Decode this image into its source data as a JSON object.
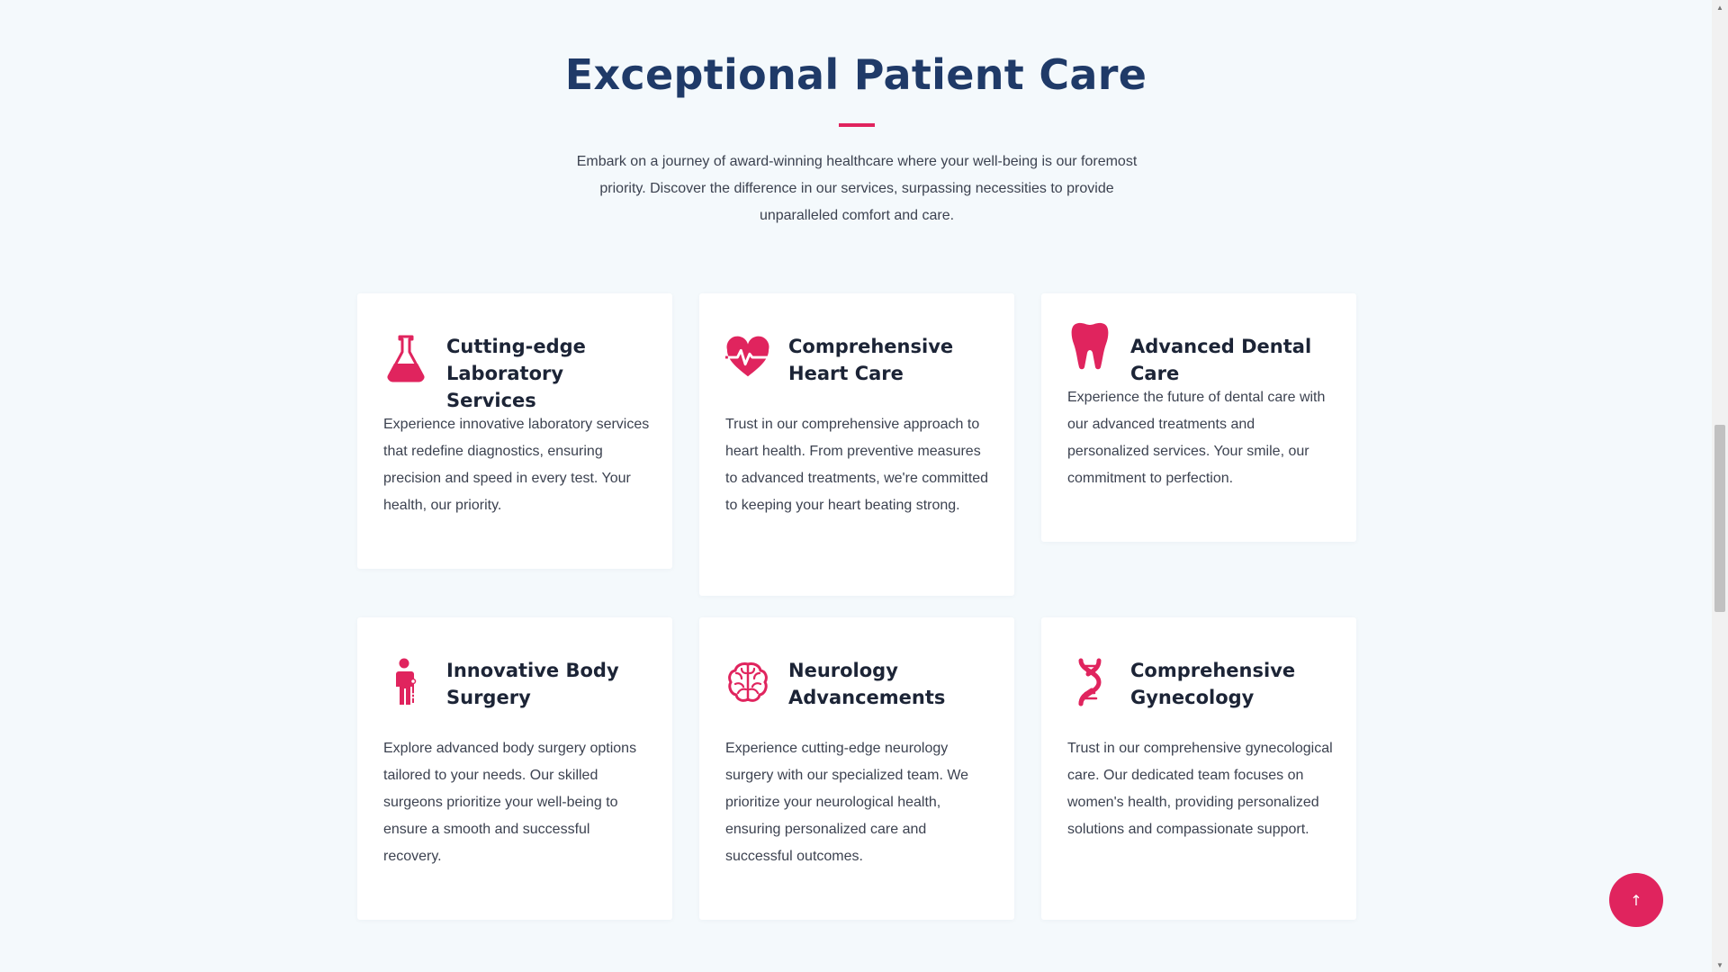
{
  "section": {
    "title": "Exceptional Patient Care",
    "intro": "Embark on a journey of award-winning healthcare where your well-being is our foremost priority. Discover the difference in our services, surpassing necessities to provide unparalleled comfort and care."
  },
  "colors": {
    "accent": "#e0245e",
    "heading": "#1f3a68",
    "background": "#f4f9fc"
  },
  "cards": [
    {
      "icon": "lab-flask-icon",
      "title": "Cutting-edge Laboratory Services",
      "text": "Experience innovative laboratory services that redefine diagnostics, ensuring precision and speed in every test. Your health, our priority."
    },
    {
      "icon": "heart-pulse-icon",
      "title": "Comprehensive Heart Care",
      "text": "Trust in our comprehensive approach to heart health. From preventive measures to advanced treatments, we're committed to keeping your heart beating strong."
    },
    {
      "icon": "tooth-icon",
      "title": "Advanced Dental Care",
      "text": "Experience the future of dental care with our advanced treatments and personalized services. Your smile, our commitment to perfection."
    },
    {
      "icon": "body-surgery-icon",
      "title": "Innovative Body Surgery",
      "text": "Explore advanced body surgery options tailored to your needs. Our skilled surgeons prioritize your well-being to ensure a smooth and successful recovery."
    },
    {
      "icon": "brain-icon",
      "title": "Neurology Advancements",
      "text": "Experience cutting-edge neurology surgery with our specialized team. We prioritize your neurological health, ensuring personalized care and successful outcomes."
    },
    {
      "icon": "dna-icon",
      "title": "Comprehensive Gynecology",
      "text": "Trust in our comprehensive gynecological care. Our dedicated team focuses on women's health, providing personalized solutions and compassionate support."
    }
  ],
  "back_to_top": {
    "icon": "arrow-up-icon",
    "glyph": "↑"
  }
}
